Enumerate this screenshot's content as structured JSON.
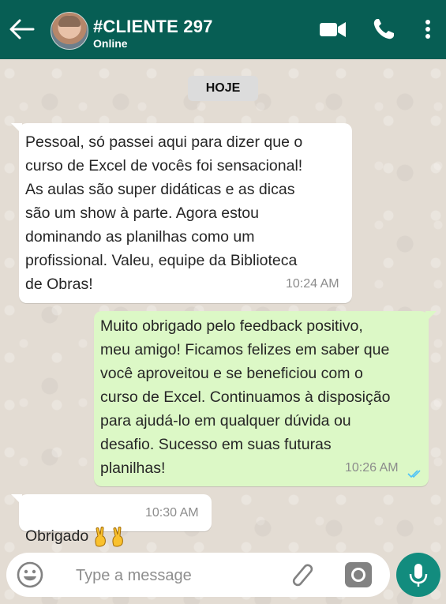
{
  "header": {
    "contact_name": "#CLIENTE 297",
    "status": "Online",
    "icons": [
      "back-arrow-icon",
      "avatar",
      "video-call-icon",
      "phone-icon",
      "more-options-icon"
    ]
  },
  "chat": {
    "date_label": "HOJE",
    "messages": [
      {
        "direction": "incoming",
        "text": "Pessoal, só passei aqui para dizer que o\ncurso de Excel de vocês foi sensacional!\nAs aulas são super didáticas e as dicas\nsão um show à parte. Agora estou\ndominando as planilhas como um\nprofissional. Valeu, equipe da Biblioteca\nde Obras!",
        "time": "10:24 AM"
      },
      {
        "direction": "outgoing",
        "text": " Muito obrigado pelo feedback positivo,\nmeu amigo! Ficamos felizes em saber que\nvocê aproveitou e se beneficiou com o\ncurso de Excel. Continuamos à disposição\npara ajudá-lo em qualquer dúvida ou\ndesafio. Sucesso em suas futuras\nplanilhas!",
        "time": "10:26 AM",
        "read_status": "read-double-check-icon"
      },
      {
        "direction": "incoming",
        "text": "Obrigado",
        "emoji": "victory-hand-emoji",
        "time": "10:30 AM"
      }
    ]
  },
  "composer": {
    "placeholder": "Type a message",
    "value": "",
    "icons": [
      "emoji-icon",
      "attach-icon",
      "camera-icon",
      "mic-icon"
    ]
  },
  "colors": {
    "header": "#075e54",
    "outgoing_bubble": "#dcf8c6",
    "incoming_bubble": "#ffffff",
    "mic_button": "#128c7e",
    "read_ticks": "#4fc3f7"
  }
}
